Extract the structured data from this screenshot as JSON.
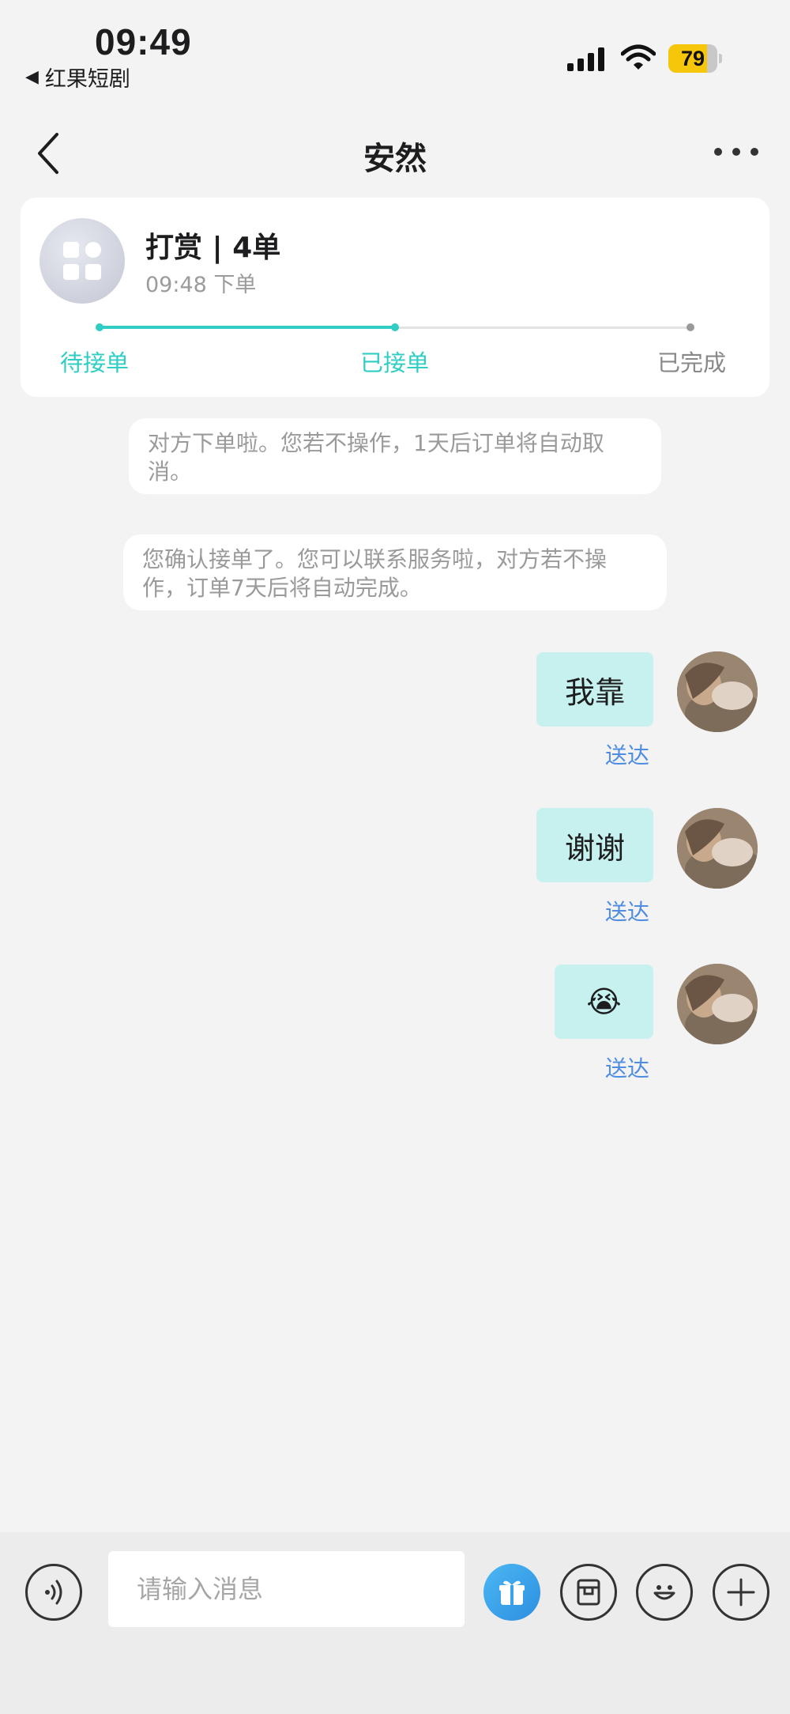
{
  "status_bar": {
    "time": "09:49",
    "back_app": "红果短剧",
    "battery": "79",
    "battery_level": 0.79
  },
  "header": {
    "title": "安然"
  },
  "order": {
    "title": "打赏 | 4单",
    "time": "09:48 下单",
    "steps": [
      "待接单",
      "已接单",
      "已完成"
    ],
    "current_step": 2,
    "accent_color": "#2fcdc3"
  },
  "system_messages": [
    "对方下单啦。您若不操作，1天后订单将自动取消。",
    "您确认接单了。您可以联系服务啦，对方若不操作，订单7天后将自动完成。"
  ],
  "messages": [
    {
      "text": "我靠",
      "status": "送达"
    },
    {
      "text": "谢谢",
      "status": "送达"
    },
    {
      "text": "😭",
      "status": "送达"
    }
  ],
  "input": {
    "placeholder": "请输入消息"
  },
  "icons": {
    "voice": "voice-icon",
    "gift": "gift-icon",
    "wallet": "wallet-icon",
    "emoji": "emoji-icon",
    "plus": "plus-icon"
  }
}
